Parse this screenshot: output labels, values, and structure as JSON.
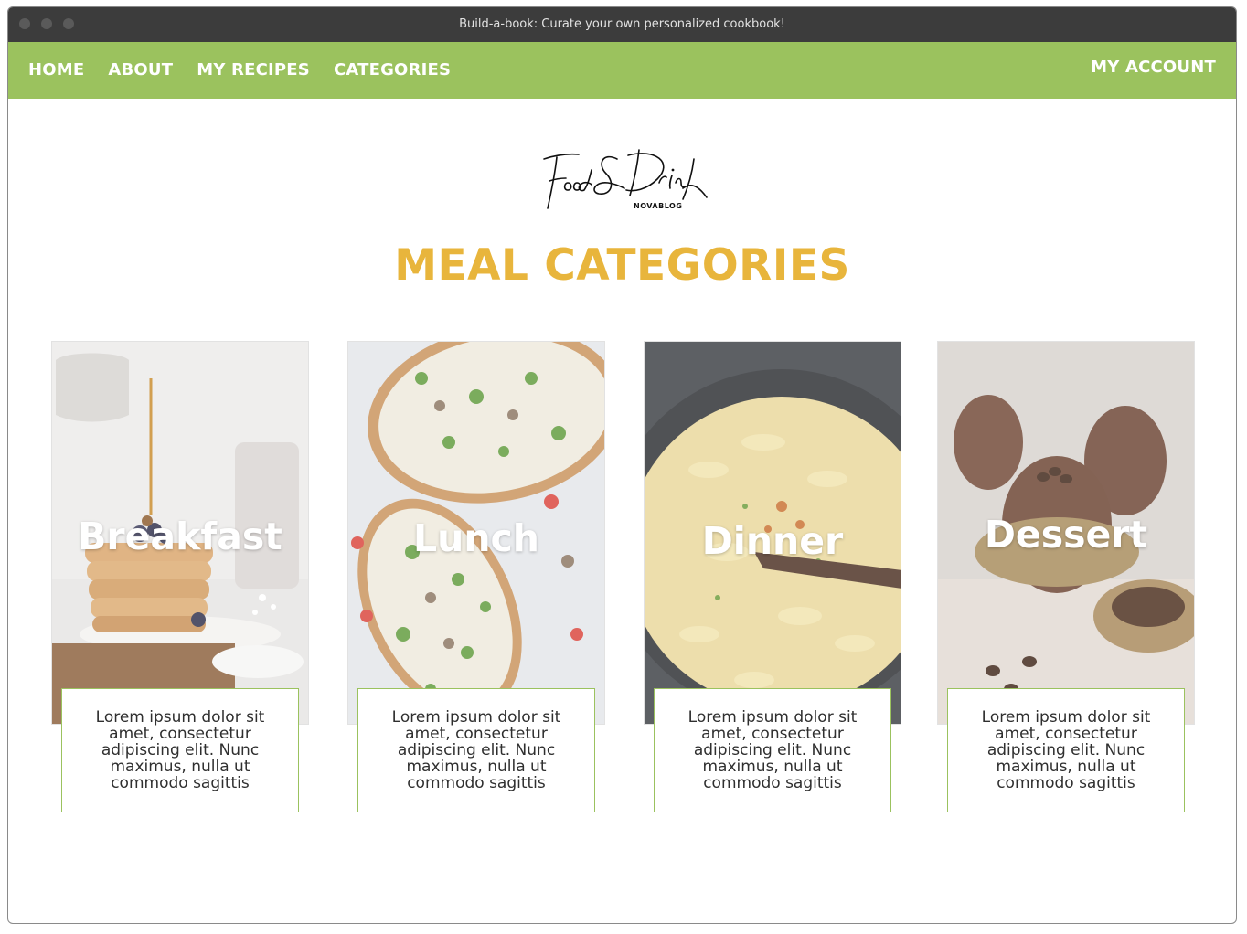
{
  "window": {
    "title": "Build-a-book: Curate your own personalized cookbook!"
  },
  "nav": {
    "items": [
      "HOME",
      "ABOUT",
      "MY RECIPES",
      "CATEGORIES"
    ],
    "account": "MY ACCOUNT",
    "color": "#9bc25e"
  },
  "logo": {
    "script": "Food & Drink",
    "subtext": "NOVABLOG"
  },
  "page": {
    "title": "MEAL CATEGORIES",
    "title_color": "#e8b53c"
  },
  "categories": [
    {
      "name": "Breakfast",
      "description": "Lorem ipsum dolor sit amet, consectetur adipiscing elit. Nunc maximus, nulla ut commodo sagittis"
    },
    {
      "name": "Lunch",
      "description": "Lorem ipsum dolor sit amet, consectetur adipiscing elit. Nunc maximus, nulla ut commodo sagittis"
    },
    {
      "name": "Dinner",
      "description": "Lorem ipsum dolor sit amet, consectetur adipiscing elit. Nunc maximus, nulla ut commodo sagittis"
    },
    {
      "name": "Dessert",
      "description": "Lorem ipsum dolor sit amet, consectetur adipiscing elit. Nunc maximus, nulla ut commodo sagittis"
    }
  ]
}
